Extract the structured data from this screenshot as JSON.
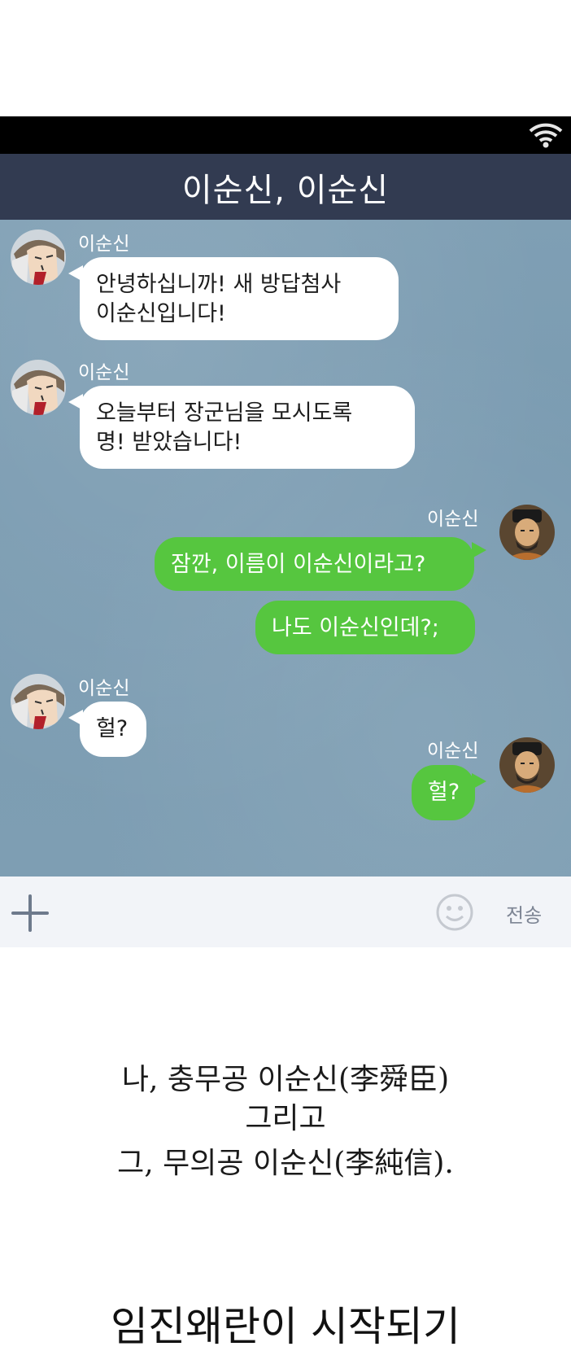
{
  "chat": {
    "title": "이순신, 이순신",
    "messages": [
      {
        "side": "in",
        "sender": "이순신",
        "text": "안녕하십니까! 새 방답첨사\n이순신입니다!"
      },
      {
        "side": "in",
        "sender": "이순신",
        "text": "오늘부터 장군님을 모시도록\n명! 받았습니다!"
      },
      {
        "side": "out",
        "sender": "이순신",
        "text": "잠깐, 이름이 이순신이라고?"
      },
      {
        "side": "out",
        "sender": "",
        "text": "나도 이순신인데?;"
      },
      {
        "side": "in",
        "sender": "이순신",
        "text": "헐?"
      },
      {
        "side": "out",
        "sender": "이순신",
        "text": "헐?"
      }
    ]
  },
  "input_bar": {
    "plus_icon": "plus-icon",
    "emoji_icon": "smiley-icon",
    "send_label": "전송"
  },
  "caption": {
    "line1": "나, 충무공 이순신(李舜臣)",
    "line2": "그리고",
    "line3": "그, 무의공 이순신(李純信).",
    "bottom": "임진왜란이 시작되기"
  },
  "colors": {
    "title_bar": "#323b51",
    "chat_bg": "#7f9fb4",
    "bubble_out": "#56c63f",
    "bubble_in": "#ffffff"
  }
}
